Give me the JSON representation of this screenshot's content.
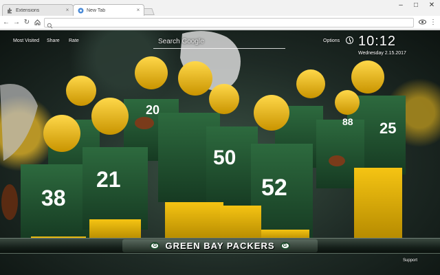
{
  "tabs": [
    {
      "title": "Extensions",
      "icon": "puzzle-icon",
      "active": false
    },
    {
      "title": "New Tab",
      "icon": "newtab-icon",
      "active": true
    }
  ],
  "address_bar": {
    "value": ""
  },
  "ntp": {
    "links": {
      "most_visited": "Most Visited",
      "share": "Share",
      "rate": "Rate",
      "options": "Options",
      "support": "Support"
    },
    "search": {
      "placeholder": "Search Google"
    },
    "clock": {
      "time": "10:12",
      "date": "Wednesday  2.15.2017"
    },
    "banner": {
      "text": "GREEN  BAY  PACKERS"
    },
    "colors": {
      "green": "#1f4d2e",
      "gold": "#f2b705",
      "white": "#ffffff"
    }
  }
}
